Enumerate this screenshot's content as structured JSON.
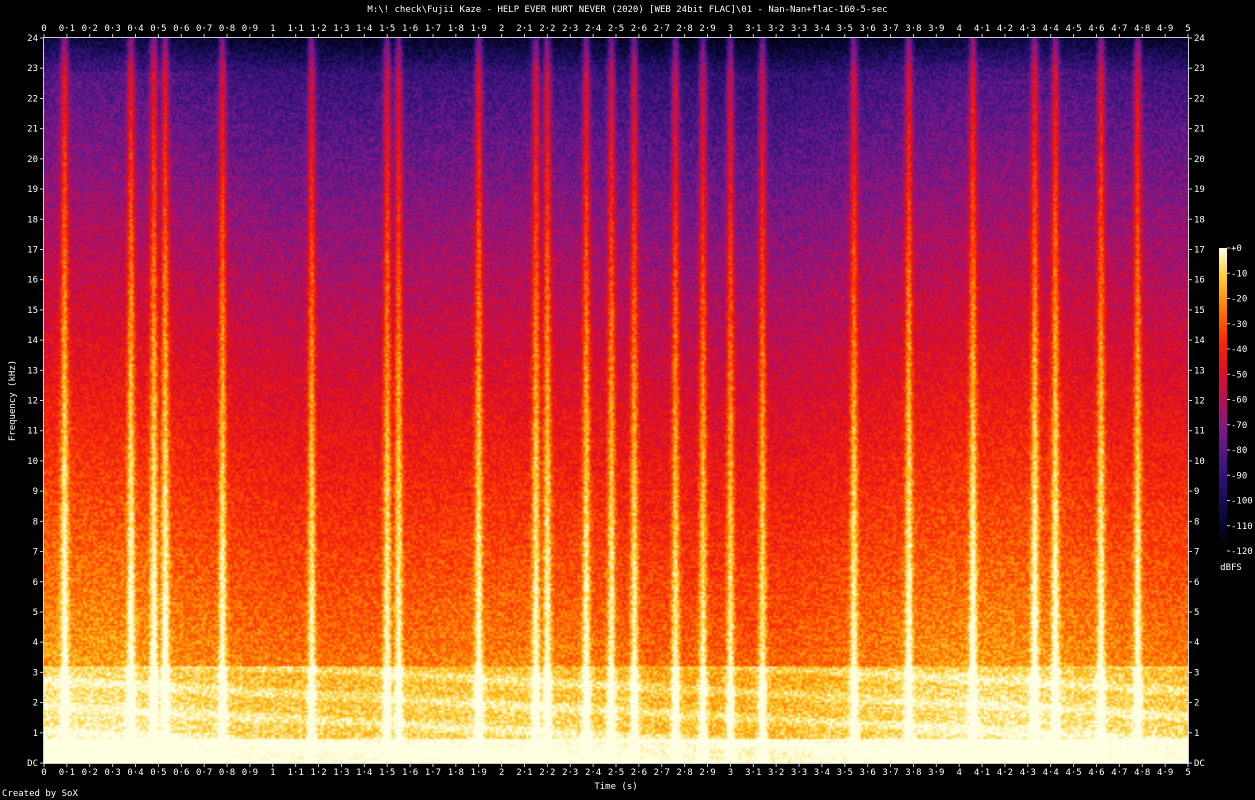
{
  "chart_data": {
    "type": "heatmap",
    "title": "M:\\! check\\Fujii Kaze - HELP EVER HURT NEVER (2020) [WEB 24bit FLAC]\\01 - Nan-Nan+flac-160-5-sec",
    "xlabel": "Time (s)",
    "ylabel": "Frequency (kHz)",
    "xlim": [
      0,
      5
    ],
    "ylim": [
      0,
      24
    ],
    "x_ticks": [
      "0",
      "0·1",
      "0·2",
      "0·3",
      "0·4",
      "0·5",
      "0·6",
      "0·7",
      "0·8",
      "0·9",
      "1",
      "1·1",
      "1·2",
      "1·3",
      "1·4",
      "1·5",
      "1·6",
      "1·7",
      "1·8",
      "1·9",
      "2",
      "2·1",
      "2·2",
      "2·3",
      "2·4",
      "2·5",
      "2·6",
      "2·7",
      "2·8",
      "2·9",
      "3",
      "3·1",
      "3·2",
      "3·3",
      "3·4",
      "3·5",
      "3·6",
      "3·7",
      "3·8",
      "3·9",
      "4",
      "4·1",
      "4·2",
      "4·3",
      "4·4",
      "4·5",
      "4·6",
      "4·7",
      "4·8",
      "4·9",
      "5"
    ],
    "y_ticks": [
      "DC",
      "1",
      "2",
      "3",
      "4",
      "5",
      "6",
      "7",
      "8",
      "9",
      "10",
      "11",
      "12",
      "13",
      "14",
      "15",
      "16",
      "17",
      "18",
      "19",
      "20",
      "21",
      "22",
      "23",
      "24"
    ],
    "colorbar": {
      "label": "dBFS",
      "ticks": [
        "+0",
        "-10",
        "-20",
        "-30",
        "-40",
        "-50",
        "-60",
        "-70",
        "-80",
        "-90",
        "-100",
        "-110",
        "-120"
      ],
      "range": [
        -120,
        0
      ]
    },
    "transients_s": [
      0.09,
      0.38,
      0.48,
      0.53,
      0.78,
      1.17,
      1.5,
      1.55,
      1.9,
      2.15,
      2.2,
      2.37,
      2.48,
      2.58,
      2.76,
      2.88,
      3.0,
      3.14,
      3.54,
      3.78,
      4.06,
      4.33,
      4.42,
      4.62,
      4.78
    ]
  },
  "footer": {
    "credit": "Created by SoX"
  }
}
